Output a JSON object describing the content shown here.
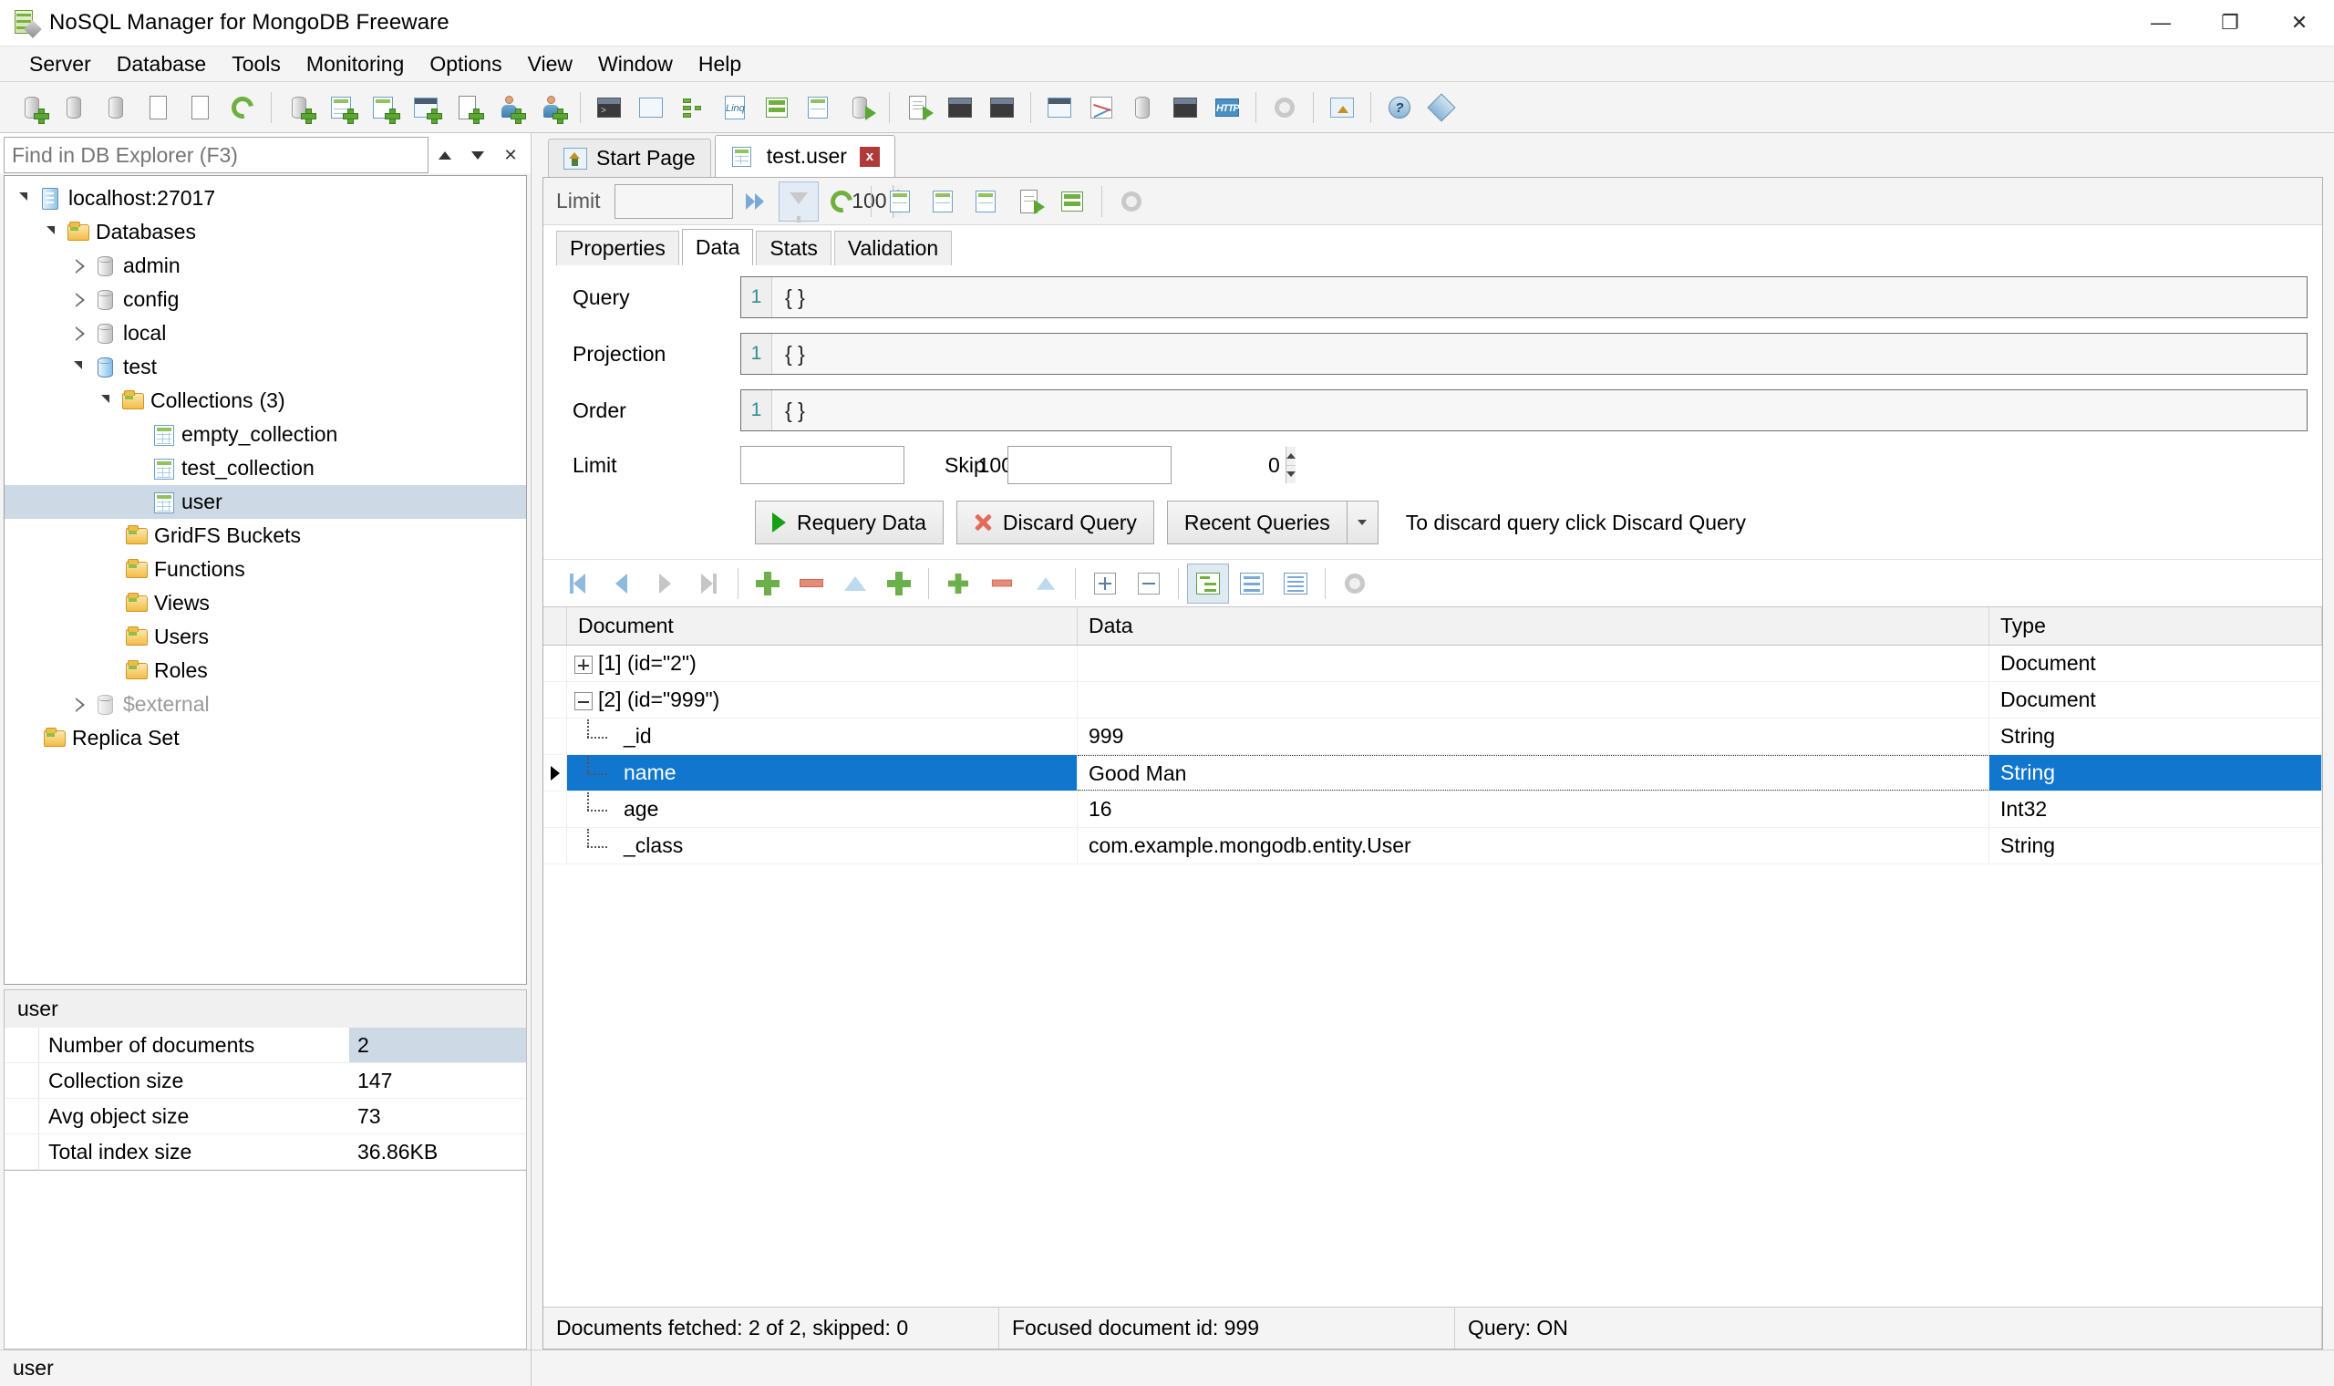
{
  "window": {
    "title": "NoSQL Manager for MongoDB Freeware",
    "app_icon": "mongodb-app-icon",
    "minimize": "—",
    "maximize": "❐",
    "close": "✕"
  },
  "menubar": [
    {
      "label": "Server"
    },
    {
      "label": "Database"
    },
    {
      "label": "Tools"
    },
    {
      "label": "Monitoring"
    },
    {
      "label": "Options"
    },
    {
      "label": "View"
    },
    {
      "label": "Window"
    },
    {
      "label": "Help"
    }
  ],
  "toolbar": {
    "groups": [
      [
        "new-connection-icon",
        "open-connection-icon",
        "save-connection-icon",
        "edit-connection-icon",
        "edit-properties-icon",
        "refresh-icon"
      ],
      [
        "new-database-icon",
        "new-collection-icon",
        "new-index-icon",
        "new-view-icon",
        "new-function-icon",
        "new-user-icon",
        "new-role-icon"
      ],
      [
        "shell-icon",
        "document-view-icon",
        "aggregation-icon",
        "linq-query-icon",
        "sql-query-icon",
        "collection-data-icon",
        "export-icon"
      ],
      [
        "export-document-icon",
        "import-data-icon",
        "export-data-icon"
      ],
      [
        "options-icon",
        "chart-icon",
        "copy-document-icon",
        "console-icon",
        "http-icon"
      ],
      [
        "settings-gear-icon"
      ],
      [
        "home-icon"
      ],
      [
        "help-icon",
        "about-icon"
      ]
    ]
  },
  "explorer": {
    "search": {
      "placeholder": "Find in DB Explorer (F3)",
      "value": "",
      "prev_label": "▲",
      "next_label": "▼",
      "clear_label": "✕"
    },
    "tree": [
      {
        "label": "localhost:27017",
        "icon": "server-icon",
        "indent": 0,
        "state": "open",
        "selected": false
      },
      {
        "label": "Databases",
        "icon": "folder-icon",
        "indent": 1,
        "state": "open",
        "selected": false
      },
      {
        "label": "admin",
        "icon": "database-icon",
        "indent": 2,
        "state": "closed",
        "selected": false
      },
      {
        "label": "config",
        "icon": "database-icon",
        "indent": 2,
        "state": "closed",
        "selected": false
      },
      {
        "label": "local",
        "icon": "database-icon",
        "indent": 2,
        "state": "closed",
        "selected": false
      },
      {
        "label": "test",
        "icon": "database-active-icon",
        "indent": 2,
        "state": "open",
        "selected": false
      },
      {
        "label": "Collections",
        "count": "(3)",
        "icon": "folder-icon",
        "indent": 3,
        "state": "open",
        "selected": false
      },
      {
        "label": "empty_collection",
        "icon": "collection-icon",
        "indent": 4,
        "state": "leaf",
        "selected": false
      },
      {
        "label": "test_collection",
        "icon": "collection-icon",
        "indent": 4,
        "state": "leaf",
        "selected": false
      },
      {
        "label": "user",
        "icon": "collection-icon",
        "indent": 4,
        "state": "leaf",
        "selected": true
      },
      {
        "label": "GridFS Buckets",
        "icon": "folder-icon",
        "indent": 3,
        "state": "leaf",
        "selected": false
      },
      {
        "label": "Functions",
        "icon": "folder-icon",
        "indent": 3,
        "state": "leaf",
        "selected": false
      },
      {
        "label": "Views",
        "icon": "folder-icon",
        "indent": 3,
        "state": "leaf",
        "selected": false
      },
      {
        "label": "Users",
        "icon": "folder-icon",
        "indent": 3,
        "state": "leaf",
        "selected": false
      },
      {
        "label": "Roles",
        "icon": "folder-icon",
        "indent": 3,
        "state": "leaf",
        "selected": false
      },
      {
        "label": "$external",
        "icon": "database-dim-icon",
        "indent": 2,
        "state": "closed",
        "selected": false,
        "dim": true
      },
      {
        "label": "Replica Set",
        "icon": "folder-icon",
        "indent": 1,
        "state": "leaf",
        "selected": false
      }
    ],
    "stats_header": "user",
    "stats_rows": [
      {
        "key": "Number of documents",
        "value": "2",
        "selected": true
      },
      {
        "key": "Collection size",
        "value": "147",
        "selected": false
      },
      {
        "key": "Avg object size",
        "value": "73",
        "selected": false
      },
      {
        "key": "Total index size",
        "value": "36.86KB",
        "selected": false
      }
    ],
    "status": "user"
  },
  "workspace": {
    "tabs": [
      {
        "label": "Start Page",
        "icon": "home-icon",
        "active": false,
        "closable": false
      },
      {
        "label": "test.user",
        "icon": "collection-icon",
        "active": true,
        "closable": true,
        "close_label": "x"
      }
    ],
    "query_toolbar": {
      "limit_label": "Limit",
      "limit_value": "100",
      "buttons": [
        "fetch-next-icon",
        "filter-icon",
        "refresh-icon",
        "save-document-icon",
        "save-as-icon",
        "copy-to-collection-icon",
        "export-document-icon",
        "insert-row-icon",
        "grid-options-icon"
      ]
    },
    "subtabs": [
      {
        "label": "Properties",
        "active": false
      },
      {
        "label": "Data",
        "active": true
      },
      {
        "label": "Stats",
        "active": false
      },
      {
        "label": "Validation",
        "active": false
      }
    ],
    "form": {
      "query_label": "Query",
      "query_line_no": "1",
      "query_value": "{ }",
      "projection_label": "Projection",
      "projection_line_no": "1",
      "projection_value": "{ }",
      "order_label": "Order",
      "order_line_no": "1",
      "order_value": "{ }",
      "limit_label": "Limit",
      "limit_value": "100",
      "skip_label": "Skip",
      "skip_value": "0"
    },
    "actions": {
      "requery_label": "Requery Data",
      "discard_label": "Discard Query",
      "recent_label": "Recent Queries",
      "dropdown_label": "▼",
      "hint": "To discard query click Discard Query"
    },
    "grid_toolbar": {
      "buttons": [
        "first-record-icon",
        "prev-record-icon",
        "next-record-icon",
        "last-record-icon",
        "add-document-icon",
        "delete-document-icon",
        "edit-document-icon",
        "duplicate-document-icon",
        "add-field-icon",
        "delete-field-icon",
        "edit-field-icon",
        "expand-all-icon",
        "collapse-all-icon",
        "tree-view-icon",
        "table-view-icon",
        "text-view-icon",
        "grid-settings-icon"
      ]
    },
    "grid": {
      "columns": [
        "Document",
        "Data",
        "Type"
      ],
      "rows": [
        {
          "kind": "doc",
          "expander": "plus",
          "document": "[1] (id=\"2\")",
          "data": "",
          "type": "Document",
          "selected": false,
          "cursor": false
        },
        {
          "kind": "doc",
          "expander": "minus",
          "document": "[2] (id=\"999\")",
          "data": "",
          "type": "Document",
          "selected": false,
          "cursor": false
        },
        {
          "kind": "field",
          "expander": "none",
          "document": "_id",
          "data": "999",
          "type": "String",
          "selected": false,
          "cursor": false
        },
        {
          "kind": "field",
          "expander": "none",
          "document": "name",
          "data": "Good Man",
          "type": "String",
          "selected": true,
          "cursor": true
        },
        {
          "kind": "field",
          "expander": "none",
          "document": "age",
          "data": "16",
          "type": "Int32",
          "selected": false,
          "cursor": false
        },
        {
          "kind": "field",
          "expander": "none",
          "document": "_class",
          "data": "com.example.mongodb.entity.User",
          "type": "String",
          "selected": false,
          "cursor": false
        }
      ]
    },
    "status": {
      "fetched": "Documents fetched: 2 of 2, skipped: 0",
      "focused": "Focused document id: 999",
      "query": "Query: ON"
    }
  },
  "colors": {
    "selection_blue": "#1076ce",
    "tree_selection": "#cdd9e5",
    "chrome": "#f4f4f4",
    "accent_green": "#6bb04a"
  }
}
